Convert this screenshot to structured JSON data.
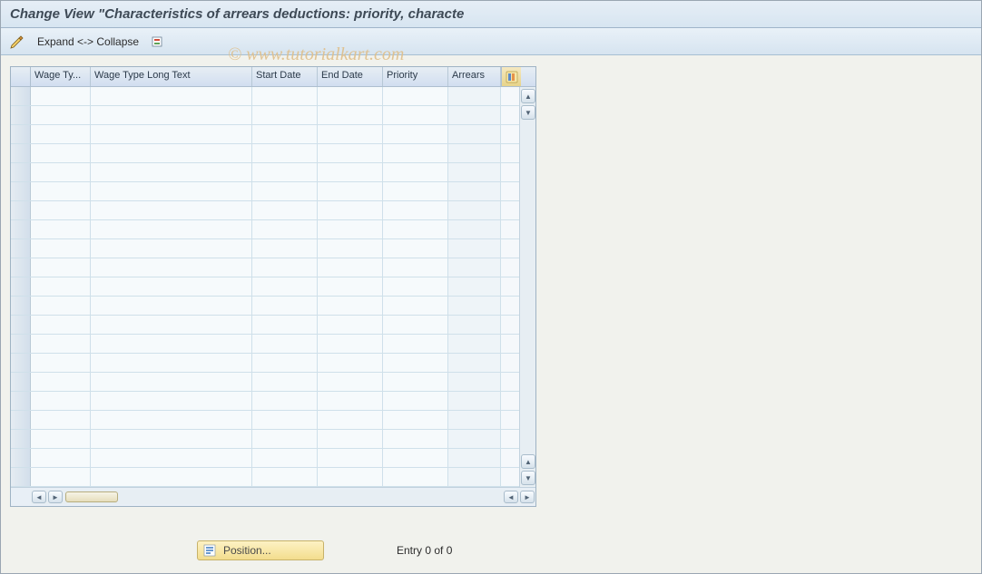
{
  "title": "Change View \"Characteristics of arrears deductions: priority, characte",
  "watermark": "© www.tutorialkart.com",
  "toolbar": {
    "expandCollapse": "Expand <-> Collapse"
  },
  "grid": {
    "columns": [
      "Wage Ty...",
      "Wage Type Long Text",
      "Start Date",
      "End Date",
      "Priority",
      "Arrears"
    ],
    "rowCount": 21
  },
  "footer": {
    "positionLabel": "Position...",
    "entryText": "Entry 0 of 0"
  },
  "icons": {
    "pencil": "pencil-icon",
    "wand": "wand-icon",
    "settings": "settings-icon",
    "position": "position-icon"
  }
}
